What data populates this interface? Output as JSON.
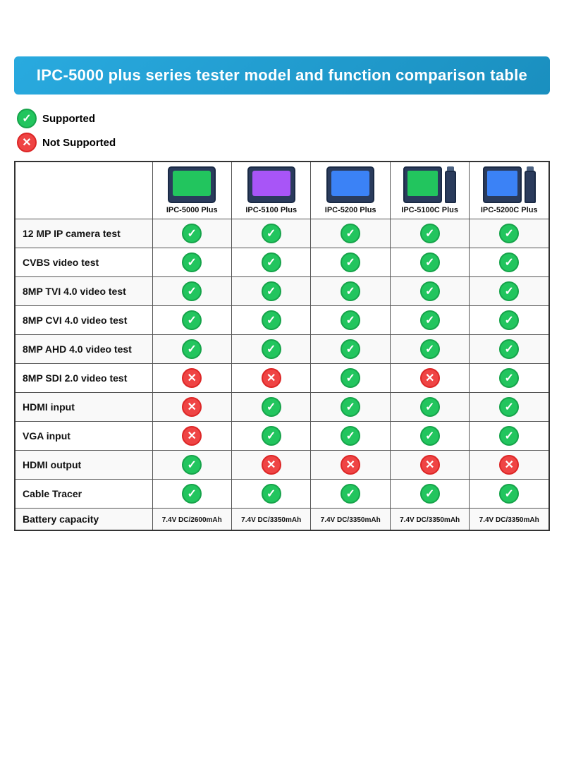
{
  "title": "IPC-5000 plus series tester model and function comparison table",
  "legend": {
    "supported_label": "Supported",
    "not_supported_label": "Not Supported"
  },
  "models": [
    {
      "id": "ipc5000plus",
      "name": "IPC-5000 Plus",
      "screen_color": "screen-green",
      "is_stick": false
    },
    {
      "id": "ipc5100plus",
      "name": "IPC-5100 Plus",
      "screen_color": "screen-purple",
      "is_stick": false
    },
    {
      "id": "ipc5200plus",
      "name": "IPC-5200 Plus",
      "screen_color": "screen-blue",
      "is_stick": false
    },
    {
      "id": "ipc5100cplus",
      "name": "IPC-5100C Plus",
      "screen_color": "screen-green",
      "is_stick": true
    },
    {
      "id": "ipc5200cplus",
      "name": "IPC-5200C Plus",
      "screen_color": "screen-blue",
      "is_stick": false
    }
  ],
  "features": [
    {
      "label": "12 MP IP camera test",
      "values": [
        "check",
        "check",
        "check",
        "check",
        "check"
      ]
    },
    {
      "label": "CVBS video test",
      "values": [
        "check",
        "check",
        "check",
        "check",
        "check"
      ]
    },
    {
      "label": "8MP TVI 4.0 video test",
      "values": [
        "check",
        "check",
        "check",
        "check",
        "check"
      ]
    },
    {
      "label": "8MP CVI 4.0 video test",
      "values": [
        "check",
        "check",
        "check",
        "check",
        "check"
      ]
    },
    {
      "label": "8MP AHD 4.0 video test",
      "values": [
        "check",
        "check",
        "check",
        "check",
        "check"
      ]
    },
    {
      "label": "8MP SDI 2.0 video test",
      "values": [
        "cross",
        "cross",
        "check",
        "cross",
        "check"
      ]
    },
    {
      "label": "HDMI input",
      "values": [
        "cross",
        "check",
        "check",
        "check",
        "check"
      ]
    },
    {
      "label": "VGA input",
      "values": [
        "cross",
        "check",
        "check",
        "check",
        "check"
      ]
    },
    {
      "label": "HDMI output",
      "values": [
        "check",
        "cross",
        "cross",
        "cross",
        "cross"
      ]
    },
    {
      "label": "Cable Tracer",
      "values": [
        "check",
        "check",
        "check",
        "check",
        "check"
      ]
    },
    {
      "label": "Battery capacity",
      "values": [
        "7.4V DC/2600mAh",
        "7.4V DC/3350mAh",
        "7.4V DC/3350mAh",
        "7.4V DC/3350mAh",
        "7.4V DC/3350mAh"
      ],
      "is_text": true
    }
  ]
}
